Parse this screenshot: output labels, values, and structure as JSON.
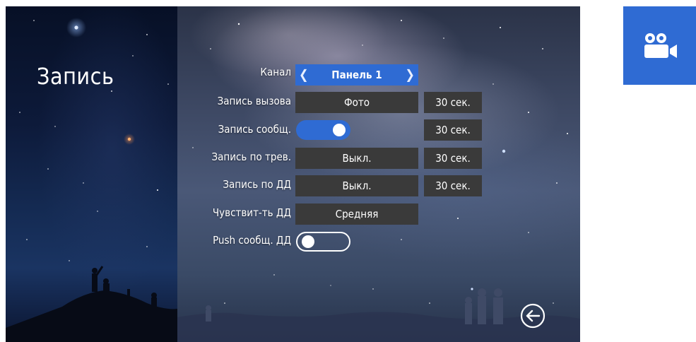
{
  "screen": {
    "title": "Запись",
    "rows": {
      "channel": {
        "label": "Канал",
        "value": "Панель 1"
      },
      "call_record": {
        "label": "Запись вызова",
        "value": "Фото",
        "duration": "30 сек."
      },
      "message_record": {
        "label": "Запись сообщ.",
        "state": "on",
        "duration": "30 сек."
      },
      "alarm_record": {
        "label": "Запись по трев.",
        "value": "Выкл.",
        "duration": "30 сек."
      },
      "motion_record": {
        "label": "Запись по ДД",
        "value": "Выкл.",
        "duration": "30 сек."
      },
      "motion_sensitivity": {
        "label": "Чувствит-ть ДД",
        "value": "Средняя"
      },
      "motion_push": {
        "label": "Push сообщ. ДД",
        "state": "off"
      }
    }
  },
  "icons": {
    "back": "back-arrow-circle-icon",
    "camera": "video-camera-icon",
    "chevron_left": "chevron-left-icon",
    "chevron_right": "chevron-right-icon"
  },
  "colors": {
    "accent": "#2f6bd3",
    "control_bg": "#3a3a3a",
    "text": "#ffffff"
  }
}
